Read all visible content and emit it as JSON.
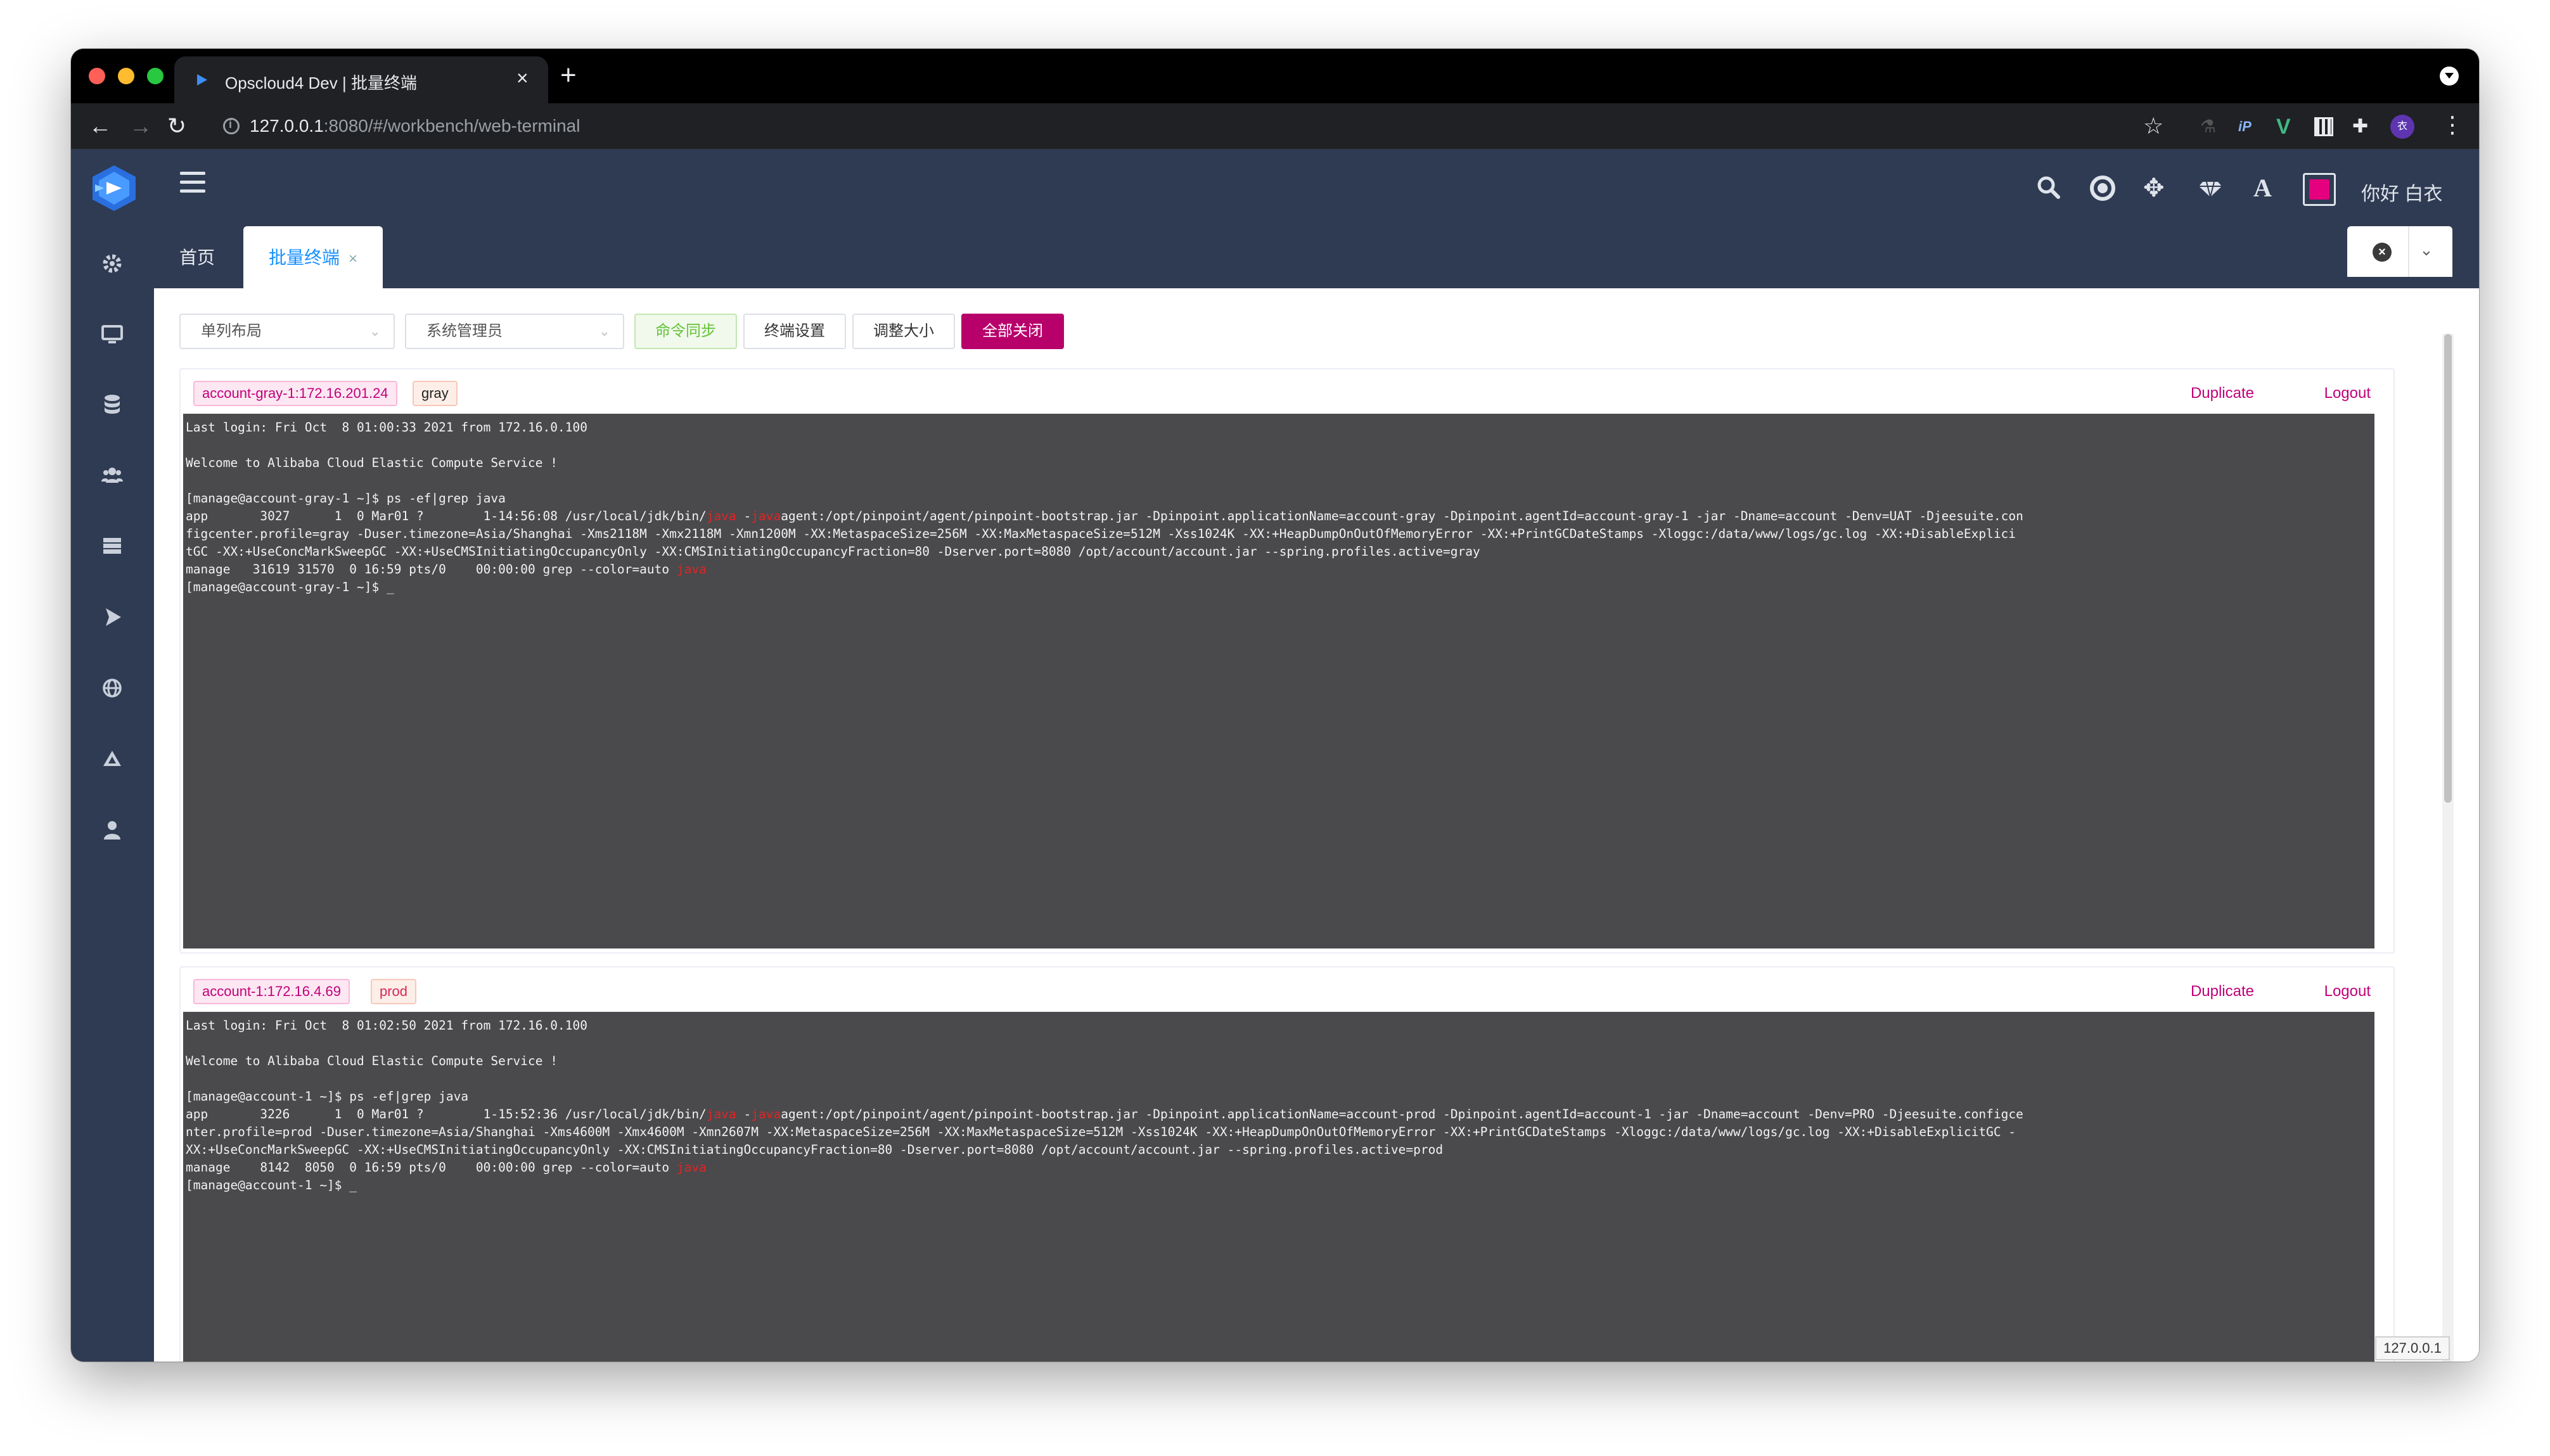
{
  "browser": {
    "tab_title": "Opscloud4 Dev | 批量终端",
    "tab_close": "×",
    "new_tab": "+",
    "url_host": "127.0.0.1",
    "url_rest": ":8080/#/workbench/web-terminal",
    "profile_initial": "衣"
  },
  "header": {
    "greeting": "你好 白衣",
    "font_glyph": "A"
  },
  "tabs": {
    "home": "首页",
    "batch_terminal": "批量终端",
    "batch_close": "×"
  },
  "toolbar": {
    "layout_select": "单列布局",
    "user_select": "系统管理员",
    "sync_button": "命令同步",
    "settings_button": "终端设置",
    "resize_button": "调整大小",
    "close_all_button": "全部关闭"
  },
  "panels": [
    {
      "server_tag": "account-gray-1:172.16.201.24",
      "env_tag": "gray",
      "duplicate": "Duplicate",
      "logout": "Logout",
      "lines": {
        "l1": "Last login: Fri Oct  8 01:00:33 2021 from 172.16.0.100",
        "l2": "Welcome to Alibaba Cloud Elastic Compute Service !",
        "l3": "[manage@account-gray-1 ~]$ ps -ef|grep java",
        "l4a": "app       3027      1  0 Mar01 ?        1-14:56:08 /usr/local/jdk/bin/",
        "l4b": "java",
        "l4c": " -",
        "l4d": "java",
        "l4e": "agent:/opt/pinpoint/agent/pinpoint-bootstrap.jar -Dpinpoint.applicationName=account-gray -Dpinpoint.agentId=account-gray-1 -jar -Dname=account -Denv=UAT -Djeesuite.con",
        "l5": "figcenter.profile=gray -Duser.timezone=Asia/Shanghai -Xms2118M -Xmx2118M -Xmn1200M -XX:MetaspaceSize=256M -XX:MaxMetaspaceSize=512M -Xss1024K -XX:+HeapDumpOnOutOfMemoryError -XX:+PrintGCDateStamps -Xloggc:/data/www/logs/gc.log -XX:+DisableExplici",
        "l6": "tGC -XX:+UseConcMarkSweepGC -XX:+UseCMSInitiatingOccupancyOnly -XX:CMSInitiatingOccupancyFraction=80 -Dserver.port=8080 /opt/account/account.jar --spring.profiles.active=gray",
        "l7a": "manage   31619 31570  0 16:59 pts/0    00:00:00 grep --color=auto ",
        "l7b": "java",
        "l8": "[manage@account-gray-1 ~]$ _"
      }
    },
    {
      "server_tag": "account-1:172.16.4.69",
      "env_tag": "prod",
      "duplicate": "Duplicate",
      "logout": "Logout",
      "lines": {
        "l1": "Last login: Fri Oct  8 01:02:50 2021 from 172.16.0.100",
        "l2": "Welcome to Alibaba Cloud Elastic Compute Service !",
        "l3": "[manage@account-1 ~]$ ps -ef|grep java",
        "l4a": "app       3226      1  0 Mar01 ?        1-15:52:36 /usr/local/jdk/bin/",
        "l4b": "java",
        "l4c": " -",
        "l4d": "java",
        "l4e": "agent:/opt/pinpoint/agent/pinpoint-bootstrap.jar -Dpinpoint.applicationName=account-prod -Dpinpoint.agentId=account-1 -jar -Dname=account -Denv=PRO -Djeesuite.configce",
        "l5": "nter.profile=prod -Duser.timezone=Asia/Shanghai -Xms4600M -Xmx4600M -Xmn2607M -XX:MetaspaceSize=256M -XX:MaxMetaspaceSize=512M -Xss1024K -XX:+HeapDumpOnOutOfMemoryError -XX:+PrintGCDateStamps -Xloggc:/data/www/logs/gc.log -XX:+DisableExplicitGC -",
        "l6": "XX:+UseConcMarkSweepGC -XX:+UseCMSInitiatingOccupancyOnly -XX:CMSInitiatingOccupancyFraction=80 -Dserver.port=8080 /opt/account/account.jar --spring.profiles.active=prod",
        "l7a": "manage    8142  8050  0 16:59 pts/0    00:00:00 grep --color=auto ",
        "l7b": "java",
        "l8": "[manage@account-1 ~]$ _"
      }
    }
  ],
  "status_tip": "127.0.0.1",
  "colors": {
    "header_bg": "#2f3b52",
    "accent_pink": "#b8006b",
    "tab_active": "#1890ff",
    "terminal_bg": "#4a4a4d"
  }
}
